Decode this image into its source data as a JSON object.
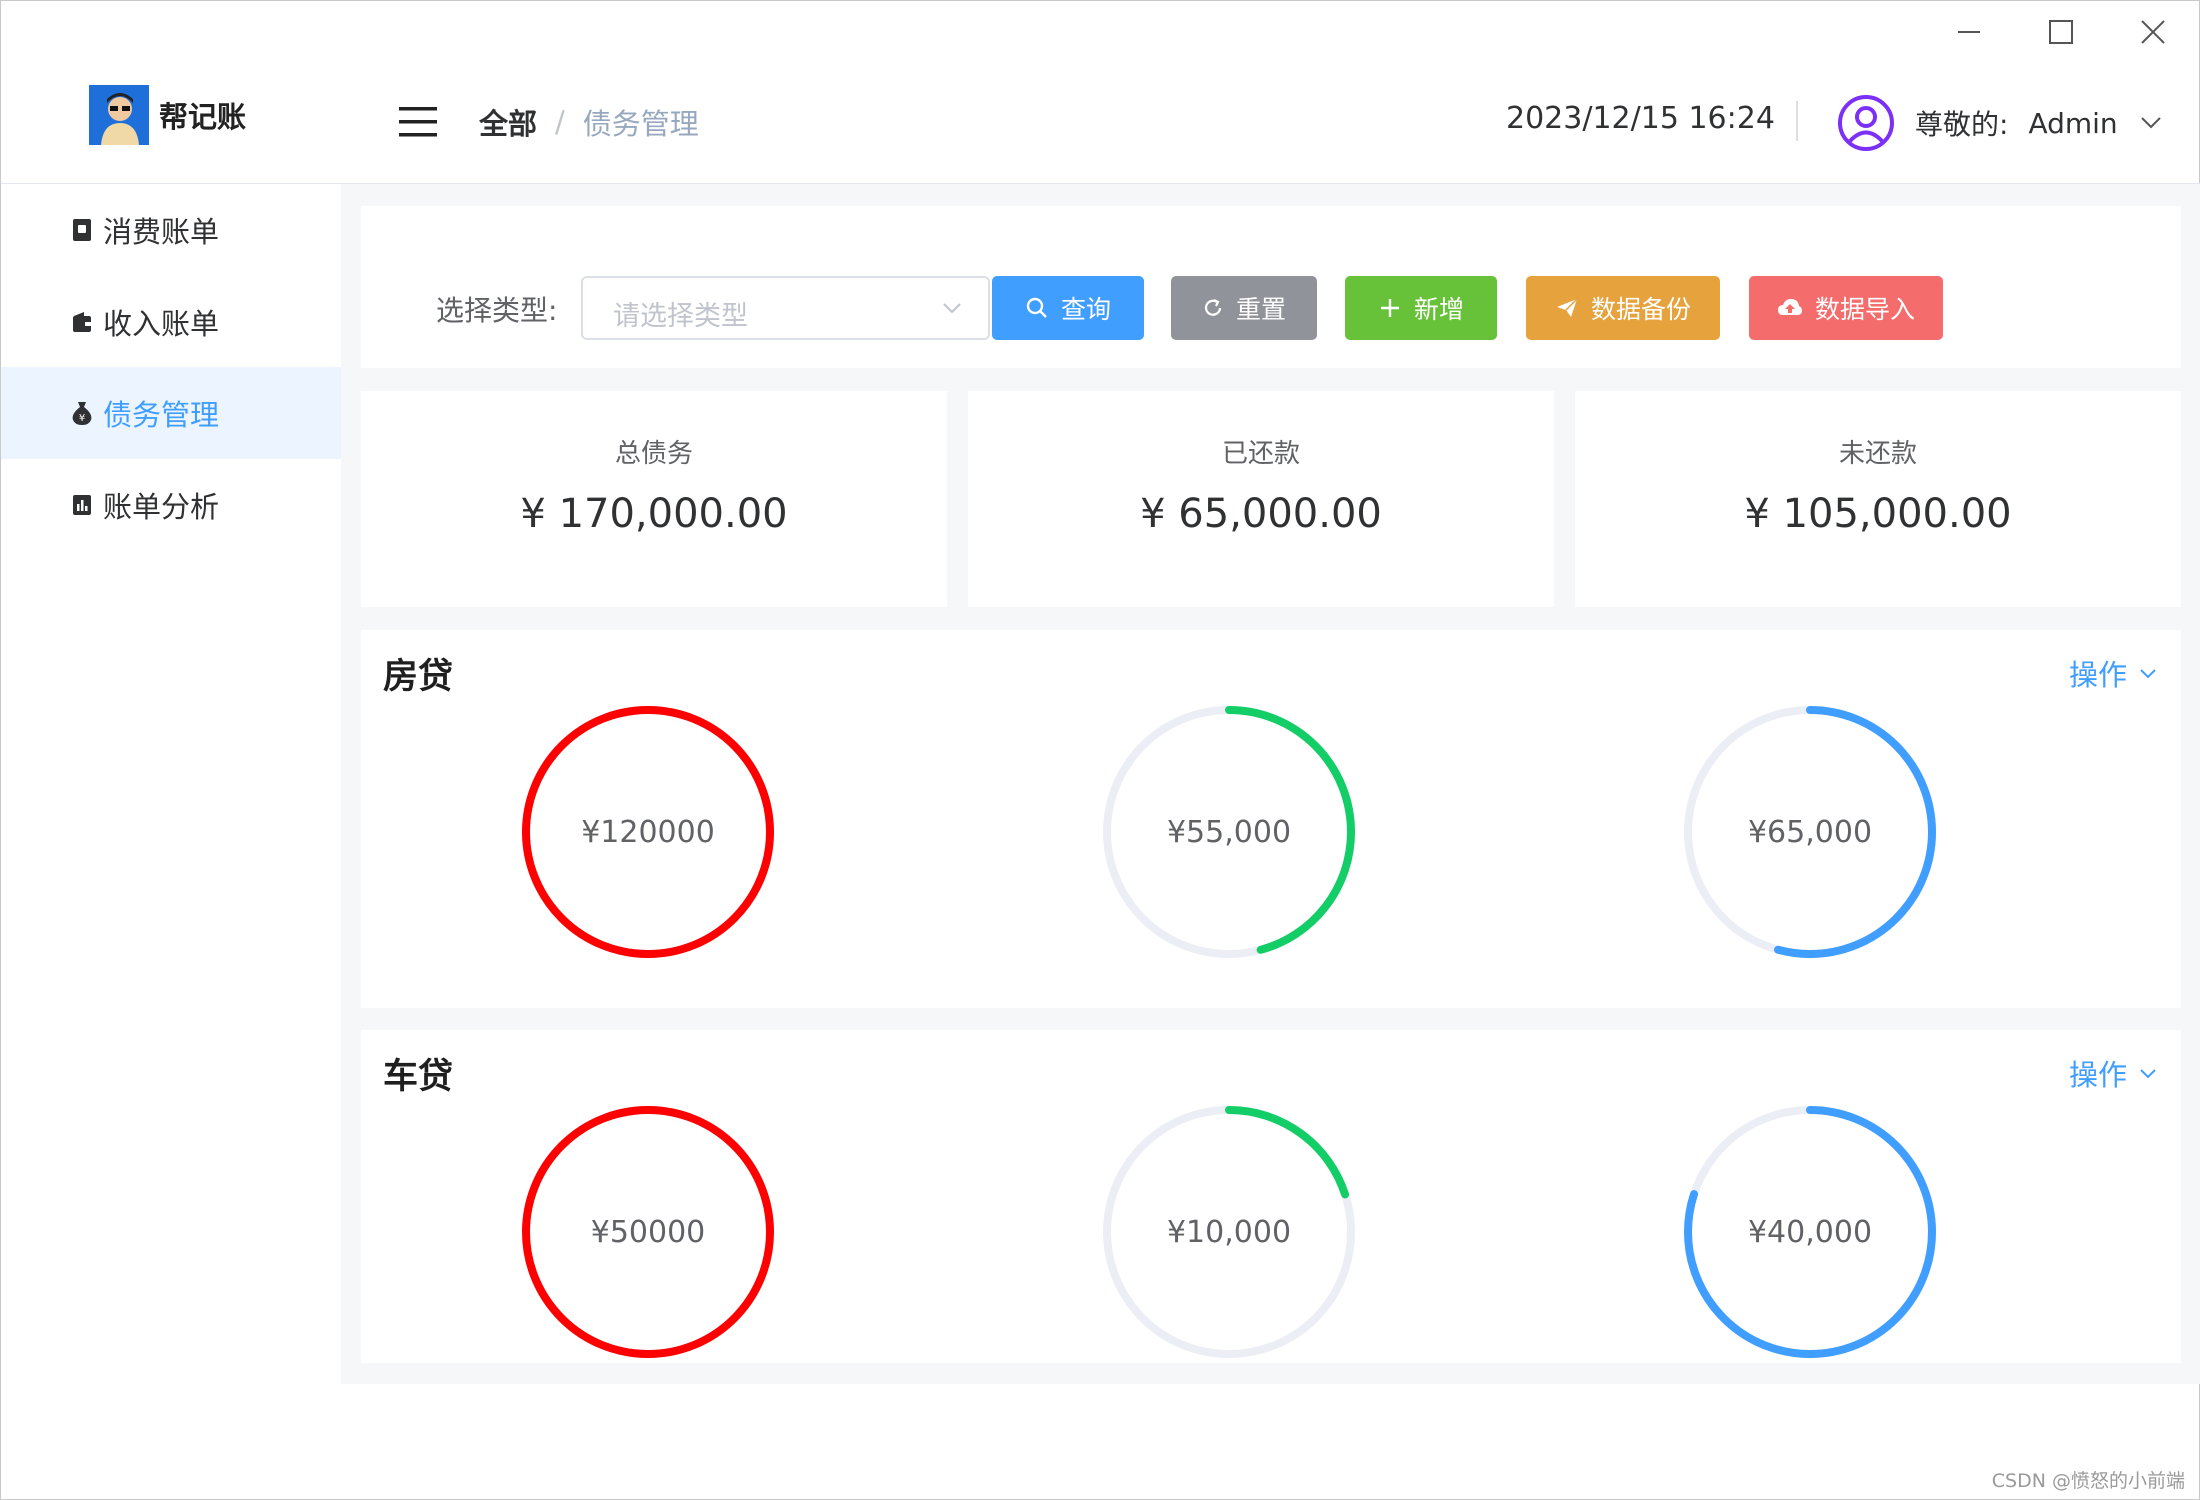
{
  "app": {
    "name": "帮记账"
  },
  "breadcrumb": {
    "first": "全部",
    "separator": "/",
    "second": "债务管理"
  },
  "header": {
    "datetime": "2023/12/15 16:24",
    "greeting": "尊敬的:",
    "username": "Admin"
  },
  "sidebar": {
    "items": [
      {
        "label": "消费账单",
        "icon": "receipt-icon",
        "active": false
      },
      {
        "label": "收入账单",
        "icon": "wallet-icon",
        "active": false
      },
      {
        "label": "债务管理",
        "icon": "money-bag-icon",
        "active": true
      },
      {
        "label": "账单分析",
        "icon": "bar-chart-icon",
        "active": false
      }
    ]
  },
  "filter": {
    "label": "选择类型:",
    "placeholder": "请选择类型",
    "buttons": {
      "query": "查询",
      "reset": "重置",
      "add": "新增",
      "backup": "数据备份",
      "import": "数据导入"
    }
  },
  "colors": {
    "query": "#409eff",
    "reset": "#909399",
    "add": "#67c23a",
    "backup": "#e6a23c",
    "import": "#f56c6c",
    "total_ring": "#ff0000",
    "paid_ring": "#13ce66",
    "unpaid_ring": "#409eff",
    "track": "#ebeef5"
  },
  "stats": [
    {
      "title": "总债务",
      "value": "¥ 170,000.00"
    },
    {
      "title": "已还款",
      "value": "¥ 65,000.00"
    },
    {
      "title": "未还款",
      "value": "¥ 105,000.00"
    }
  ],
  "debts": [
    {
      "title": "房贷",
      "op_label": "操作",
      "rings": [
        {
          "label": "¥120000",
          "percent": 100
        },
        {
          "label": "¥55,000",
          "percent": 45.8
        },
        {
          "label": "¥65,000",
          "percent": 54.2
        }
      ]
    },
    {
      "title": "车贷",
      "op_label": "操作",
      "rings": [
        {
          "label": "¥50000",
          "percent": 100
        },
        {
          "label": "¥10,000",
          "percent": 20
        },
        {
          "label": "¥40,000",
          "percent": 80
        }
      ]
    }
  ],
  "watermark": "CSDN @愤怒的小前端"
}
